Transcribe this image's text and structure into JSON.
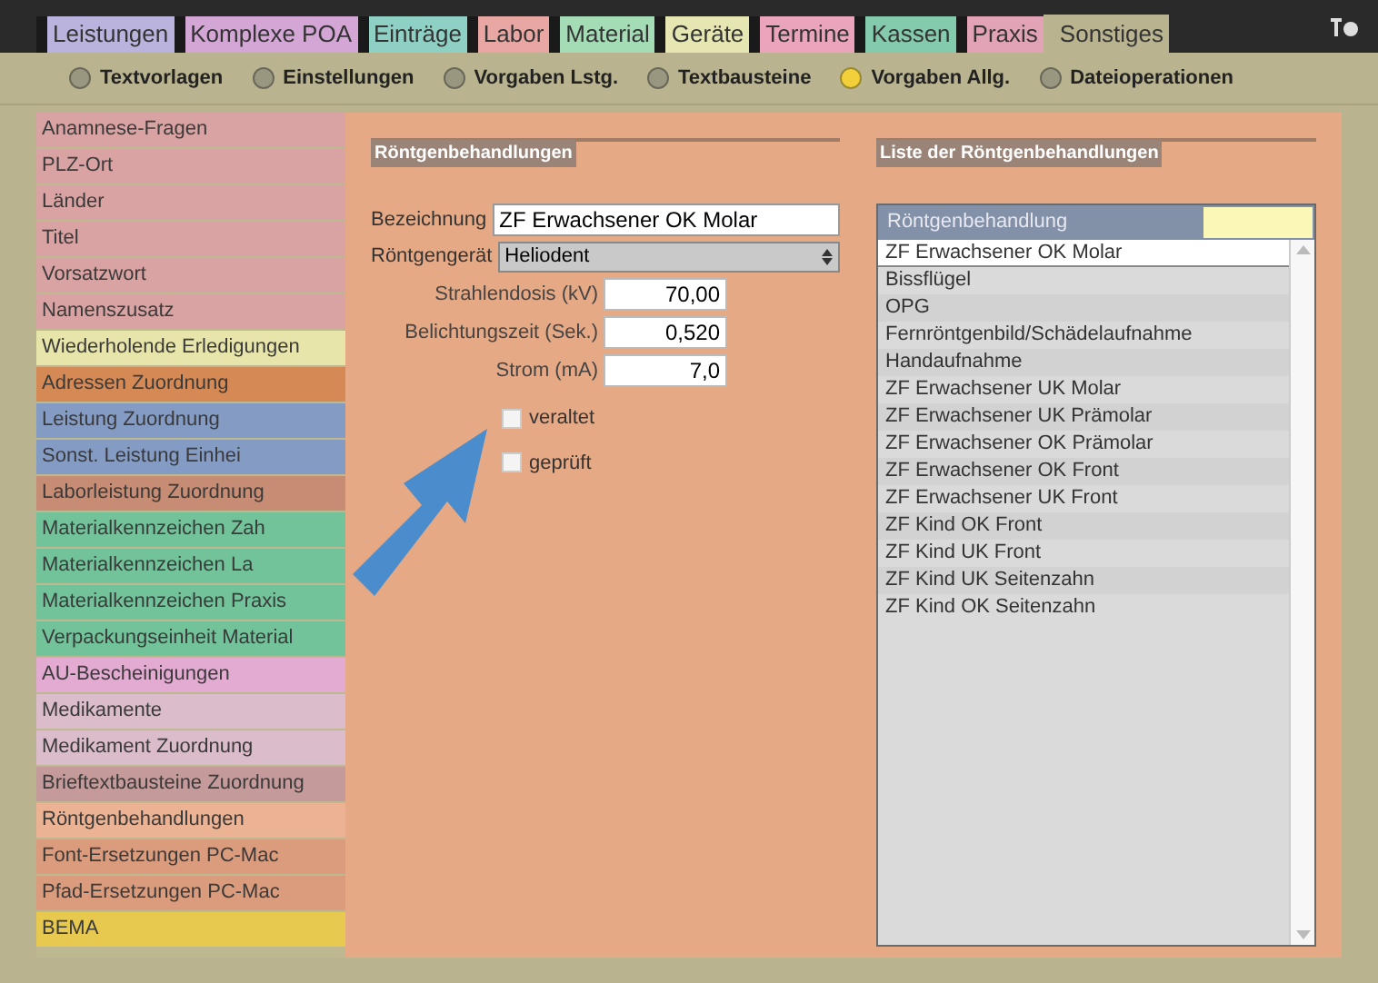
{
  "tabs": [
    {
      "label": "Leistungen",
      "color": "#b9b3dd",
      "selected": false
    },
    {
      "label": "Komplexe POA",
      "color": "#d3a6d6",
      "selected": false
    },
    {
      "label": "Einträge",
      "color": "#8fd0c4",
      "selected": false
    },
    {
      "label": "Labor",
      "color": "#e9a7a3",
      "selected": false
    },
    {
      "label": "Material",
      "color": "#a3dcb5",
      "selected": false
    },
    {
      "label": "Geräte",
      "color": "#e6e6b3",
      "selected": false
    },
    {
      "label": "Termine",
      "color": "#eaa5bd",
      "selected": false
    },
    {
      "label": "Kassen",
      "color": "#84cbae",
      "selected": false
    },
    {
      "label": "Praxis",
      "color": "#e3a3b6",
      "selected": false
    },
    {
      "label": "Sonstiges",
      "color": "#b9b48f",
      "selected": true
    }
  ],
  "subtabs": [
    {
      "label": "Textvorlagen",
      "selected": false
    },
    {
      "label": "Einstellungen",
      "selected": false
    },
    {
      "label": "Vorgaben Lstg.",
      "selected": false
    },
    {
      "label": "Textbausteine",
      "selected": false
    },
    {
      "label": "Vorgaben Allg.",
      "selected": true
    },
    {
      "label": "Dateioperationen",
      "selected": false
    }
  ],
  "sidebar": {
    "items": [
      {
        "label": "Anamnese-Fragen",
        "color": "#d9a3a3"
      },
      {
        "label": "PLZ-Ort",
        "color": "#d9a3a3"
      },
      {
        "label": "Länder",
        "color": "#d9a3a3"
      },
      {
        "label": "Titel",
        "color": "#d9a3a3"
      },
      {
        "label": "Vorsatzwort",
        "color": "#d9a3a3"
      },
      {
        "label": "Namenszusatz",
        "color": "#d9a3a3"
      },
      {
        "label": "Wiederholende Erledigungen",
        "color": "#e8e5aa"
      },
      {
        "label": "Adressen Zuordnung",
        "color": "#d58a55"
      },
      {
        "label": "Leistung Zuordnung",
        "color": "#849bc4"
      },
      {
        "label": "Sonst. Leistung Einhei",
        "color": "#849bc4"
      },
      {
        "label": "Laborleistung Zuordnung",
        "color": "#c68c74"
      },
      {
        "label": "Materialkennzeichen Zah",
        "color": "#72c39a"
      },
      {
        "label": "Materialkennzeichen La",
        "color": "#72c39a"
      },
      {
        "label": "Materialkennzeichen Praxis",
        "color": "#72c39a"
      },
      {
        "label": "Verpackungseinheit Material",
        "color": "#72c39a"
      },
      {
        "label": "AU-Bescheinigungen",
        "color": "#e3abd2"
      },
      {
        "label": "Medikamente",
        "color": "#dbbccb"
      },
      {
        "label": "Medikament Zuordnung",
        "color": "#dbbccb"
      },
      {
        "label": "Brieftextbausteine Zuordnung",
        "color": "#c49a9a"
      },
      {
        "label": "Röntgenbehandlungen",
        "color": "#ebb393"
      },
      {
        "label": "Font-Ersetzungen PC-Mac",
        "color": "#db9c7d"
      },
      {
        "label": "Pfad-Ersetzungen PC-Mac",
        "color": "#db9c7d"
      },
      {
        "label": "BEMA",
        "color": "#e8c94f"
      }
    ]
  },
  "form": {
    "title": "Röntgenbehandlungen",
    "bezeichnung": {
      "label": "Bezeichnung",
      "value": "ZF Erwachsener OK Molar"
    },
    "geraet": {
      "label": "Röntgengerät",
      "value": "Heliodent"
    },
    "numbers": [
      {
        "label": "Strahlendosis (kV)",
        "value": "70,00"
      },
      {
        "label": "Belichtungszeit (Sek.)",
        "value": "0,520"
      },
      {
        "label": "Strom (mA)",
        "value": "7,0"
      }
    ],
    "checkboxes": [
      {
        "label": "veraltet",
        "checked": false
      },
      {
        "label": "geprüft",
        "checked": false
      }
    ]
  },
  "list": {
    "title": "Liste der Röntgenbehandlungen",
    "column": "Röntgenbehandlung",
    "rows": [
      {
        "label": "ZF Erwachsener OK Molar",
        "selected": true
      },
      {
        "label": "Bissflügel",
        "selected": false
      },
      {
        "label": "OPG",
        "selected": false
      },
      {
        "label": "Fernröntgenbild/Schädelaufnahme",
        "selected": false
      },
      {
        "label": "Handaufnahme",
        "selected": false
      },
      {
        "label": "ZF Erwachsener UK Molar",
        "selected": false
      },
      {
        "label": "ZF Erwachsener UK Prämolar",
        "selected": false
      },
      {
        "label": "ZF Erwachsener OK Prämolar",
        "selected": false
      },
      {
        "label": "ZF Erwachsener OK Front",
        "selected": false
      },
      {
        "label": "ZF Erwachsener UK Front",
        "selected": false
      },
      {
        "label": "ZF Kind OK Front",
        "selected": false
      },
      {
        "label": "ZF Kind UK Front",
        "selected": false
      },
      {
        "label": "ZF Kind UK  Seitenzahn",
        "selected": false
      },
      {
        "label": "ZF Kind OK  Seitenzahn",
        "selected": false
      }
    ]
  }
}
